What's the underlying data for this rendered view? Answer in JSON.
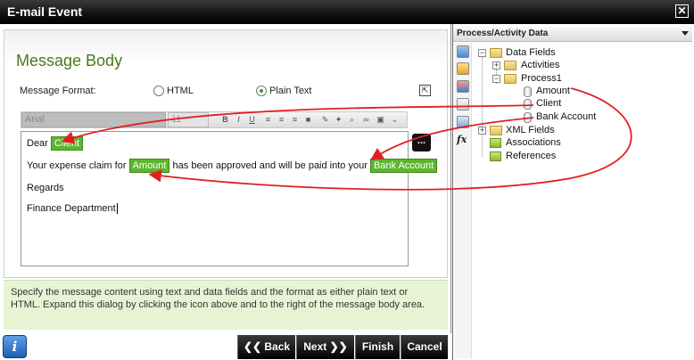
{
  "window": {
    "title": "E-mail Event"
  },
  "dialog": {
    "heading": "Message Body",
    "format_label": "Message Format:",
    "format_options": [
      {
        "label": "HTML",
        "selected": false
      },
      {
        "label": "Plain Text",
        "selected": true
      }
    ],
    "toolbar": {
      "font": "Arial",
      "size": "11",
      "buttons": [
        "B",
        "I",
        "U"
      ]
    },
    "editor": {
      "line1_prefix": "Dear",
      "field_client": "Client",
      "line2_prefix": "Your expense claim for",
      "field_amount": "Amount",
      "line2_middle": "has been approved and will be paid into your",
      "field_bank": "Bank Account",
      "line3": "Regards",
      "line4": "Finance Department"
    },
    "ellipsis_label": "...",
    "info_text": "Specify the message content using text and data fields and the format as either plain text or HTML. Expand this dialog by clicking the icon above and to the right of the message body area."
  },
  "nav": {
    "back": "Back",
    "next": "Next",
    "finish": "Finish",
    "cancel": "Cancel"
  },
  "panel": {
    "title": "Process/Activity Data",
    "tree": {
      "data_fields": "Data Fields",
      "activities": "Activities",
      "process1": "Process1",
      "amount": "Amount",
      "client": "Client",
      "bank_account": "Bank Account",
      "xml_fields": "XML Fields",
      "associations": "Associations",
      "references": "References"
    }
  },
  "colors": {
    "accent": "#5db62e",
    "heading": "#4a7a1a",
    "arrow": "#e02020"
  }
}
